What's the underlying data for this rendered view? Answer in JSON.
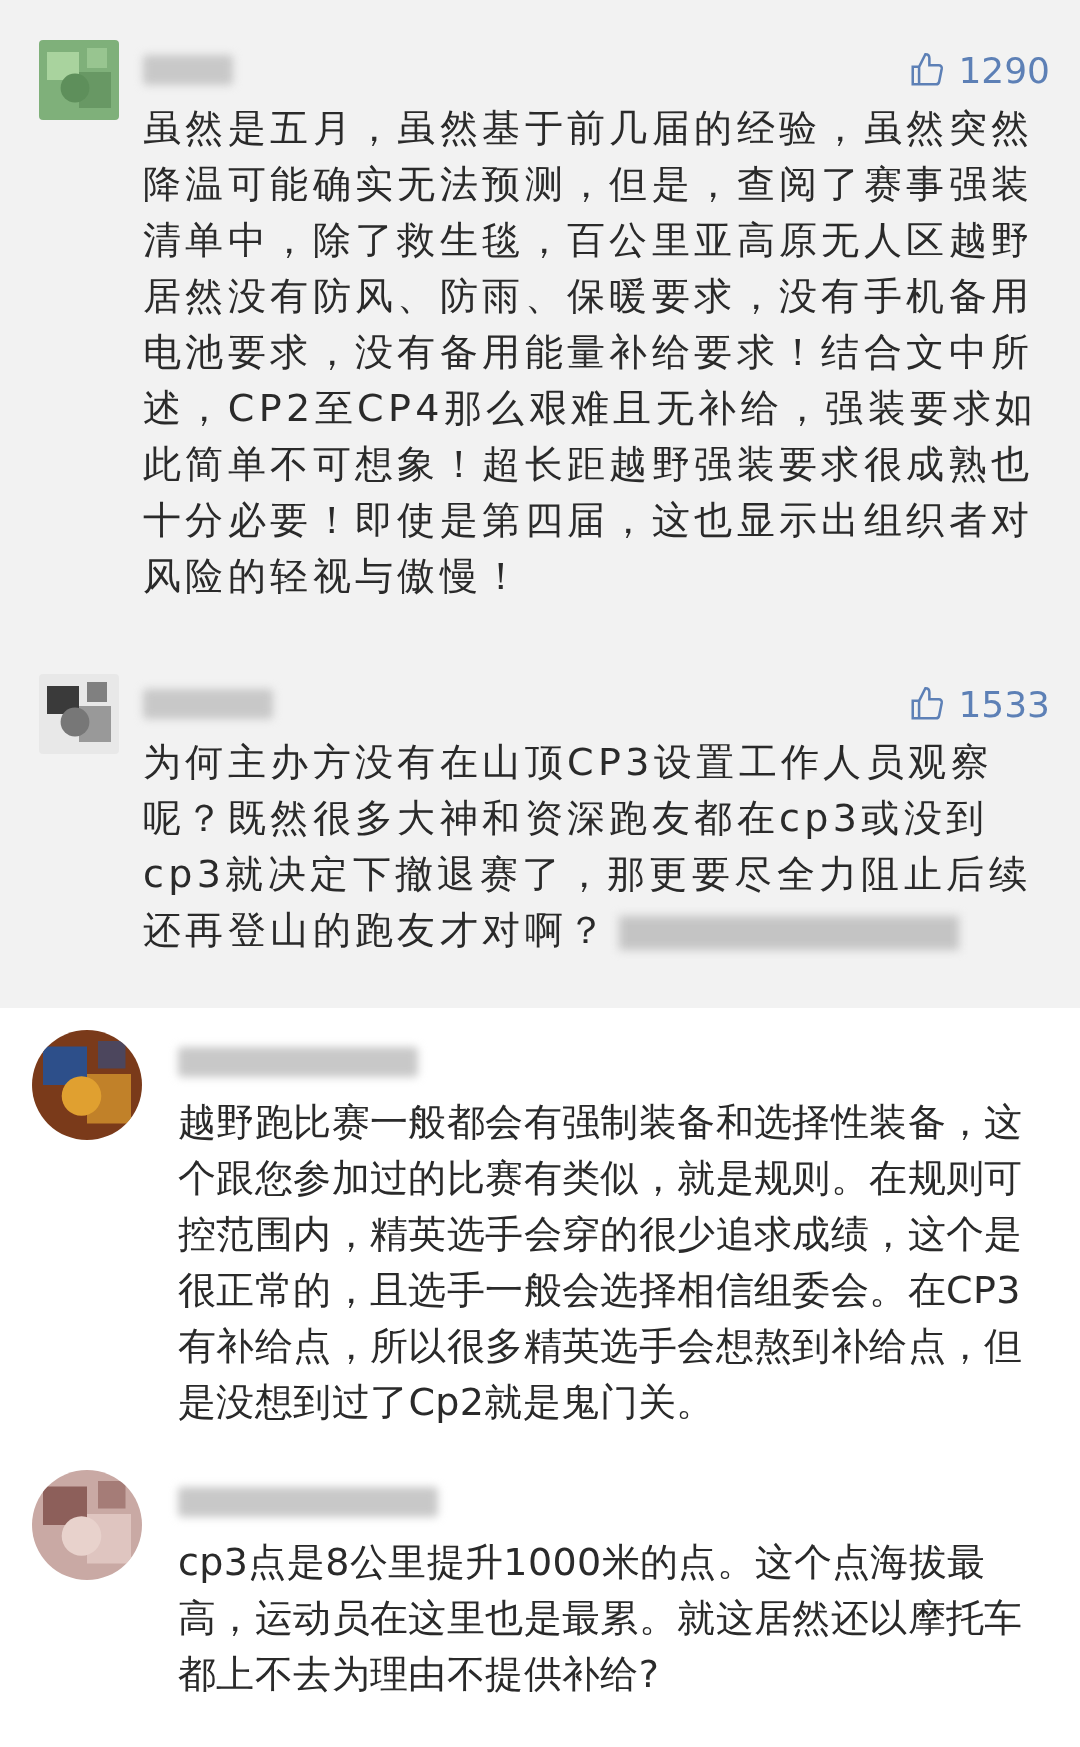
{
  "comments": [
    {
      "highlighted": true,
      "likes": "1290",
      "text": "虽然是五月，虽然基于前几届的经验，虽然突然降温可能确实无法预测，但是，查阅了赛事强装清单中，除了救生毯，百公里亚高原无人区越野居然没有防风、防雨、保暖要求，没有手机备用电池要求，没有备用能量补给要求！结合文中所述，CP2至CP4那么艰难且无补给，强装要求如此简单不可想象！超长距越野强装要求很成熟也十分必要！即使是第四届，这也显示出组织者对风险的轻视与傲慢！"
    },
    {
      "highlighted": true,
      "blurred_tail": true,
      "likes": "1533",
      "text": "为何主办方没有在山顶CP3设置工作人员观察呢？既然很多大神和资深跑友都在cp3或没到cp3就决定下撤退赛了，那更要尽全力阻止后续还再登山的跑友才对啊？"
    },
    {
      "highlighted": false,
      "text": "越野跑比赛一般都会有强制装备和选择性装备，这个跟您参加过的比赛有类似，就是规则。在规则可控范围内，精英选手会穿的很少追求成绩，这个是很正常的，且选手一般会选择相信组委会。在CP3有补给点，所以很多精英选手会想熬到补给点，但是没想到过了Cp2就是鬼门关。"
    },
    {
      "highlighted": false,
      "text": "cp3点是8公里提升1000米的点。这个点海拔最高，运动员在这里也是最累。就这居然还以摩托车都上不去为理由不提供补给?"
    }
  ]
}
